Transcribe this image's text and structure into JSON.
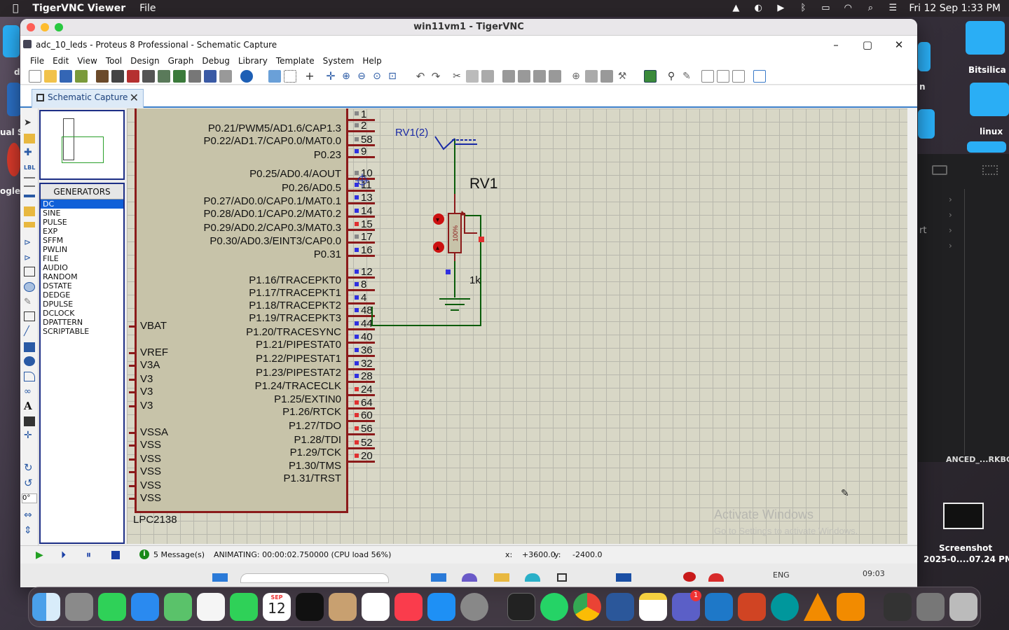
{
  "mac_menubar": {
    "app": "TigerVNC Viewer",
    "menu": "File",
    "clock": "Fri 12 Sep  1:33 PM"
  },
  "desktop_labels": {
    "bitsilica": "Bitsilica",
    "linux": "linux",
    "screenshot_line1": "Screenshot",
    "screenshot_line2": "2025-0....07.24 PM",
    "anced": "ANCED_...RKBC",
    "left_d": "d",
    "left_ual": "ual St",
    "left_ogle": "ogle",
    "right_n": "n",
    "right_rt": "rt"
  },
  "vnc": {
    "title": "win11vm1 - TigerVNC"
  },
  "proteus": {
    "title": "adc_10_leds - Proteus 8 Professional - Schematic Capture",
    "menu": [
      "File",
      "Edit",
      "View",
      "Tool",
      "Design",
      "Graph",
      "Debug",
      "Library",
      "Template",
      "System",
      "Help"
    ],
    "tab": "Schematic Capture",
    "generators_header": "GENERATORS",
    "generators": [
      "DC",
      "SINE",
      "PULSE",
      "EXP",
      "SFFM",
      "PWLIN",
      "FILE",
      "AUDIO",
      "RANDOM",
      "DSTATE",
      "DEDGE",
      "DPULSE",
      "DCLOCK",
      "DPATTERN",
      "SCRIPTABLE"
    ],
    "rotation": "0°"
  },
  "schematic": {
    "chip_name": "LPC2138",
    "right_pins": [
      {
        "label": "P0.21/PWM5/AD1.6/CAP1.3",
        "num": "2"
      },
      {
        "label": "P0.22/AD1.7/CAP0.0/MAT0.0",
        "num": "58"
      },
      {
        "label": "P0.23",
        "num": "9"
      },
      {
        "label": "P0.25/AD0.4/AOUT",
        "num": "10"
      },
      {
        "label": "P0.26/AD0.5",
        "num": "11"
      },
      {
        "label": "P0.27/AD0.0/CAP0.1/MAT0.1",
        "num": "13"
      },
      {
        "label": "P0.28/AD0.1/CAP0.2/MAT0.2",
        "num": "14"
      },
      {
        "label": "P0.29/AD0.2/CAP0.3/MAT0.3",
        "num": "15"
      },
      {
        "label": "P0.30/AD0.3/EINT3/CAP0.0",
        "num": "17"
      },
      {
        "label": "P0.31",
        "num": "16"
      },
      {
        "label": "P1.16/TRACEPKT0",
        "num": "12"
      },
      {
        "label": "P1.17/TRACEPKT1",
        "num": "8"
      },
      {
        "label": "P1.18/TRACEPKT2",
        "num": "4"
      },
      {
        "label": "P1.19/TRACEPKT3",
        "num": "48"
      },
      {
        "label": "P1.20/TRACESYNC",
        "num": "44"
      },
      {
        "label": "P1.21/PIPESTAT0",
        "num": "40"
      },
      {
        "label": "P1.22/PIPESTAT1",
        "num": "36"
      },
      {
        "label": "P1.23/PIPESTAT2",
        "num": "32"
      },
      {
        "label": "P1.24/TRACECLK",
        "num": "28"
      },
      {
        "label": "P1.25/EXTIN0",
        "num": "24"
      },
      {
        "label": "P1.26/RTCK",
        "num": "64"
      },
      {
        "label": "P1.27/TDO",
        "num": "60"
      },
      {
        "label": "P1.28/TDI",
        "num": "56"
      },
      {
        "label": "P1.29/TCK",
        "num": "52"
      },
      {
        "label": "P1.30/TMS",
        "num": "20"
      },
      {
        "label": "P1.31/TRST",
        "num": ""
      }
    ],
    "top_num": "1",
    "left_pins": [
      "VBAT",
      "VREF",
      "V3A",
      "V3",
      "V3",
      "V3",
      "VSSA",
      "VSS",
      "VSS",
      "VSS",
      "VSS",
      "VSS"
    ],
    "rv_label": "RV1(2)",
    "rv_name": "RV1",
    "rv_value": "1k",
    "rv_percent": "100%"
  },
  "status": {
    "messages": "5 Message(s)",
    "animating": "ANIMATING: 00:00:02.750000 (CPU load 56%)",
    "x_label": "x:",
    "x_val": "+3600.0",
    "y_label": "y:",
    "y_val": "-2400.0"
  },
  "watermark": {
    "line1": "Activate Windows",
    "line2": "Go to Settings to activate Windows."
  },
  "win_taskbar": {
    "lang": "ENG",
    "time": "09:03"
  },
  "dock_calendar": {
    "month": "SEP",
    "day": "12"
  }
}
